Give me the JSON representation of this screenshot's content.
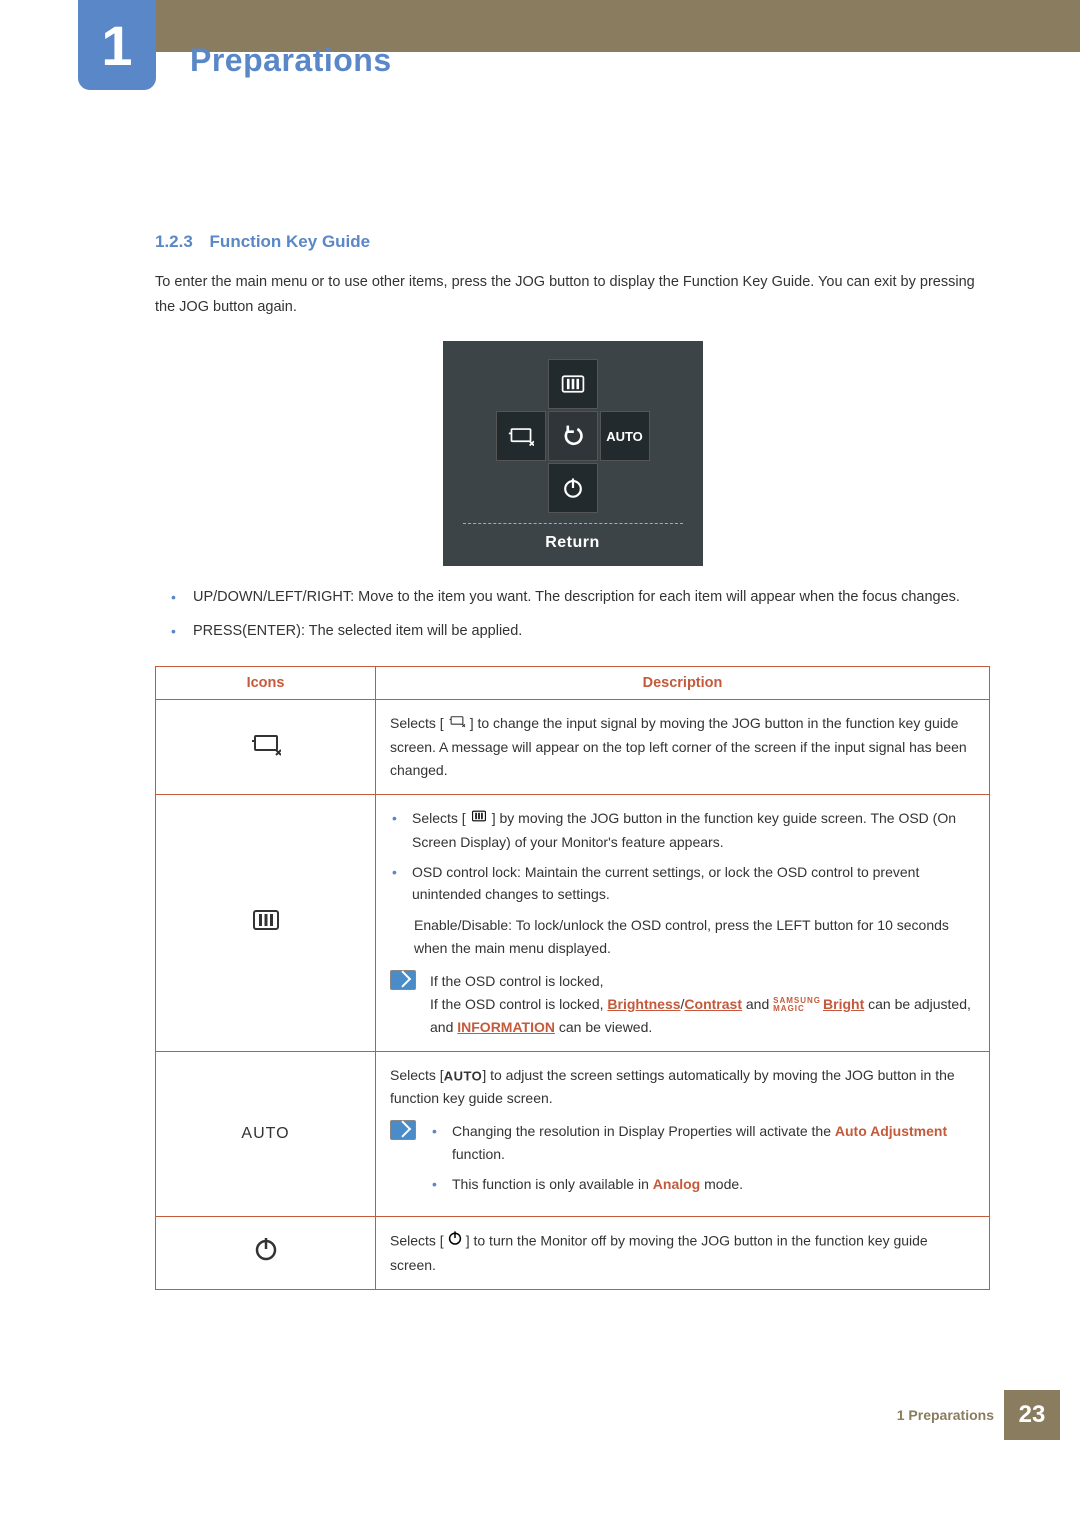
{
  "chapter": {
    "number": "1",
    "title": "Preparations"
  },
  "section": {
    "number": "1.2.3",
    "title": "Function Key Guide",
    "intro": "To enter the main menu or to use other items, press the JOG button to display the Function Key Guide. You can exit by pressing the JOG button again."
  },
  "guide_box": {
    "auto_label": "AUTO",
    "return_label": "Return"
  },
  "body_list": {
    "item1": "UP/DOWN/LEFT/RIGHT: Move to the item you want. The description for each item will appear when the focus changes.",
    "item2": "PRESS(ENTER): The selected item will be applied."
  },
  "table": {
    "header_icons": "Icons",
    "header_desc": "Description",
    "row1": {
      "text_before": "Selects [",
      "text_after": "] to change the input signal by moving the JOG button in the function key guide screen. A message will appear on the top left corner of the screen if the input signal has been changed."
    },
    "row2": {
      "b1_before": "Selects [",
      "b1_after": "] by moving the JOG button in the function key guide screen. The OSD (On Screen Display) of your Monitor's feature appears.",
      "b2": "OSD control lock: Maintain the current settings, or lock the OSD control to prevent unintended changes to settings.",
      "enable_disable": "Enable/Disable: To lock/unlock the OSD control, press the LEFT button for 10 seconds when the main menu displayed.",
      "note_line1": "If the OSD control is locked,",
      "note_line2_before": "If the OSD control is locked, ",
      "brightness": "Brightness",
      "slash": "/",
      "contrast": "Contrast",
      "note_line2_mid": " and ",
      "samsung": "SAMSUNG",
      "magic": "MAGIC",
      "bright": "Bright",
      "note_line2_mid2": " can be adjusted, and ",
      "information": "INFORMATION",
      "note_line2_after": " can be viewed."
    },
    "row3": {
      "auto_label": "AUTO",
      "text_before": "Selects [",
      "inline_auto": "AUTO",
      "text_after": "] to adjust the screen settings automatically by moving the JOG button in the function key guide screen.",
      "note_b1_before": "Changing the resolution in Display Properties will activate the ",
      "auto_adjustment": "Auto Adjustment",
      "note_b1_after": " function.",
      "note_b2_before": "This function is only available in ",
      "analog": "Analog",
      "note_b2_after": " mode."
    },
    "row4": {
      "text_before": "Selects [",
      "text_after": "] to turn the Monitor off by moving the JOG button in the function key guide screen."
    }
  },
  "footer": {
    "text": "1 Preparations",
    "page": "23"
  }
}
